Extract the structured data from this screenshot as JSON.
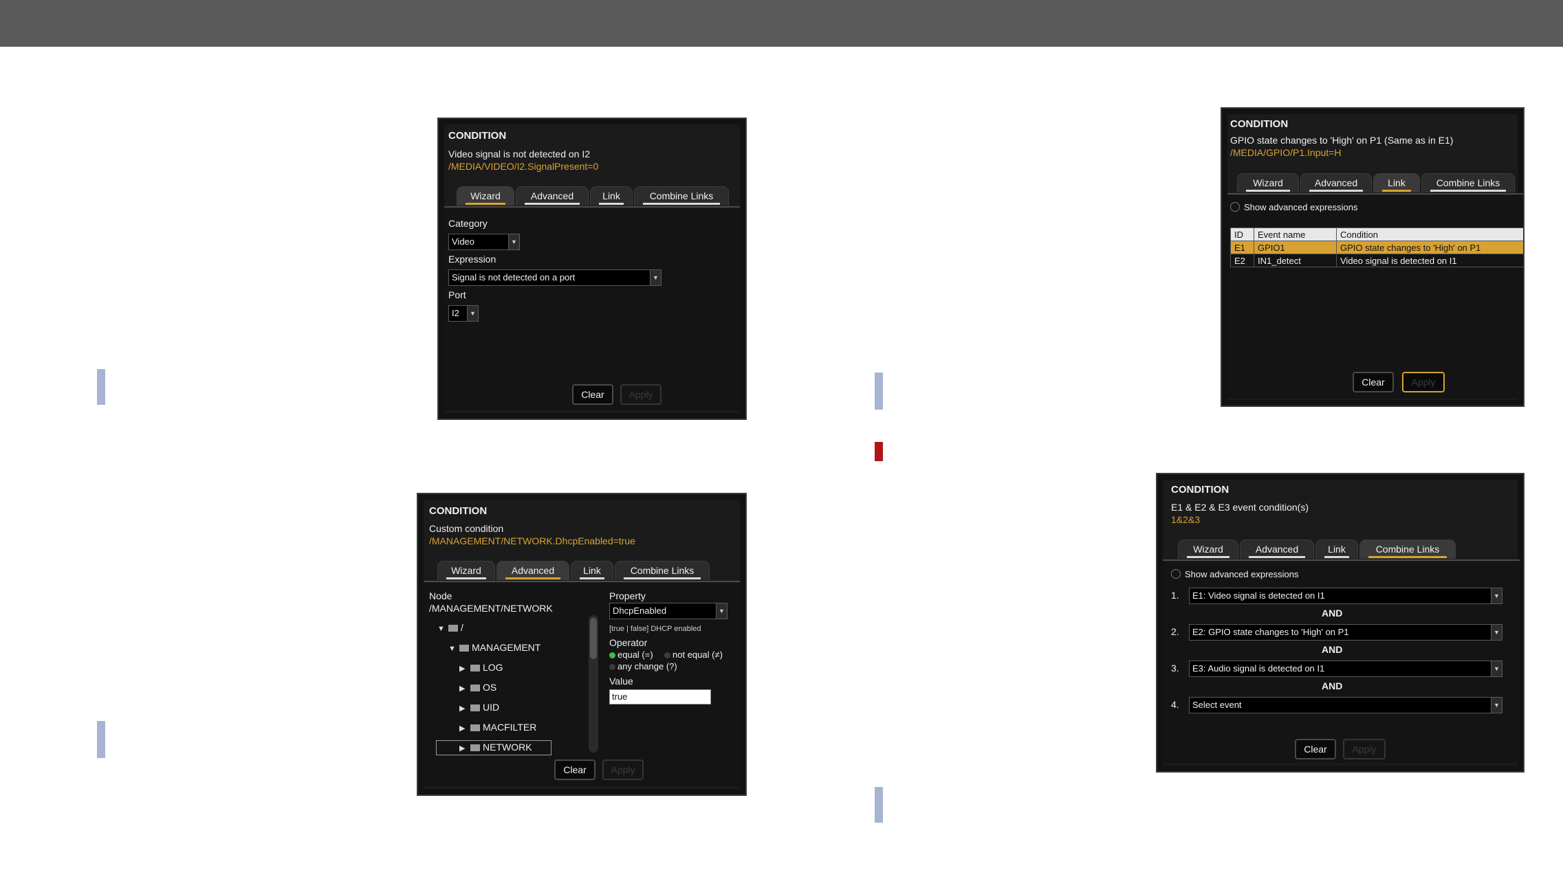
{
  "panel1": {
    "title": "CONDITION",
    "description": "Video signal is not detected on I2",
    "path": "/MEDIA/VIDEO/I2.SignalPresent=0",
    "tabs": [
      "Wizard",
      "Advanced",
      "Link",
      "Combine Links"
    ],
    "active_tab": "Wizard",
    "category_label": "Category",
    "category_value": "Video",
    "expression_label": "Expression",
    "expression_value": "Signal is not detected on a port",
    "port_label": "Port",
    "port_value": "I2",
    "clear": "Clear",
    "apply": "Apply"
  },
  "panel2": {
    "title": "CONDITION",
    "description": "Custom condition",
    "path": "/MANAGEMENT/NETWORK.DhcpEnabled=true",
    "tabs": [
      "Wizard",
      "Advanced",
      "Link",
      "Combine Links"
    ],
    "active_tab": "Advanced",
    "node_label": "Node",
    "node_value": "/MANAGEMENT/NETWORK",
    "tree": [
      {
        "label": "/",
        "arrow": "▼",
        "level": 0
      },
      {
        "label": "MANAGEMENT",
        "arrow": "▼",
        "level": 1
      },
      {
        "label": "LOG",
        "arrow": "▶",
        "level": 2
      },
      {
        "label": "OS",
        "arrow": "▶",
        "level": 2
      },
      {
        "label": "UID",
        "arrow": "▶",
        "level": 2
      },
      {
        "label": "MACFILTER",
        "arrow": "▶",
        "level": 2
      },
      {
        "label": "NETWORK",
        "arrow": "▶",
        "level": 2
      }
    ],
    "property_label": "Property",
    "property_value": "DhcpEnabled",
    "property_hint": "[true | false] DHCP enabled",
    "operator_label": "Operator",
    "op_equal": "equal (=)",
    "op_not_equal": "not equal (≠)",
    "op_any": "any change (?)",
    "value_label": "Value",
    "value": "true",
    "clear": "Clear",
    "apply": "Apply"
  },
  "panel3": {
    "title": "CONDITION",
    "description": "GPIO state changes to 'High' on P1 (Same as in E1)",
    "path": "/MEDIA/GPIO/P1.Input=H",
    "tabs": [
      "Wizard",
      "Advanced",
      "Link",
      "Combine Links"
    ],
    "active_tab": "Link",
    "show_adv": "Show advanced expressions",
    "columns": [
      "ID",
      "Event name",
      "Condition"
    ],
    "rows": [
      {
        "id": "E1",
        "name": "GPIO1",
        "condition": "GPIO state changes to 'High' on P1"
      },
      {
        "id": "E2",
        "name": "IN1_detect",
        "condition": "Video signal is detected on I1"
      }
    ],
    "clear": "Clear",
    "apply": "Apply"
  },
  "panel4": {
    "title": "CONDITION",
    "description": "E1 & E2 & E3 event condition(s)",
    "path": "1&2&3",
    "tabs": [
      "Wizard",
      "Advanced",
      "Link",
      "Combine Links"
    ],
    "active_tab": "Combine Links",
    "show_adv": "Show advanced expressions",
    "items": [
      {
        "num": "1.",
        "value": "E1: Video signal is detected on I1"
      },
      {
        "num": "2.",
        "value": "E2: GPIO state changes to 'High' on P1"
      },
      {
        "num": "3.",
        "value": "E3: Audio signal is detected on I1"
      },
      {
        "num": "4.",
        "value": "Select event"
      }
    ],
    "and": "AND",
    "clear": "Clear",
    "apply": "Apply"
  },
  "colors": {
    "accent": "#d8a233",
    "marker_blue": "#a7b4d2",
    "marker_red": "#b01417",
    "topbar": "#5a5a5a"
  }
}
